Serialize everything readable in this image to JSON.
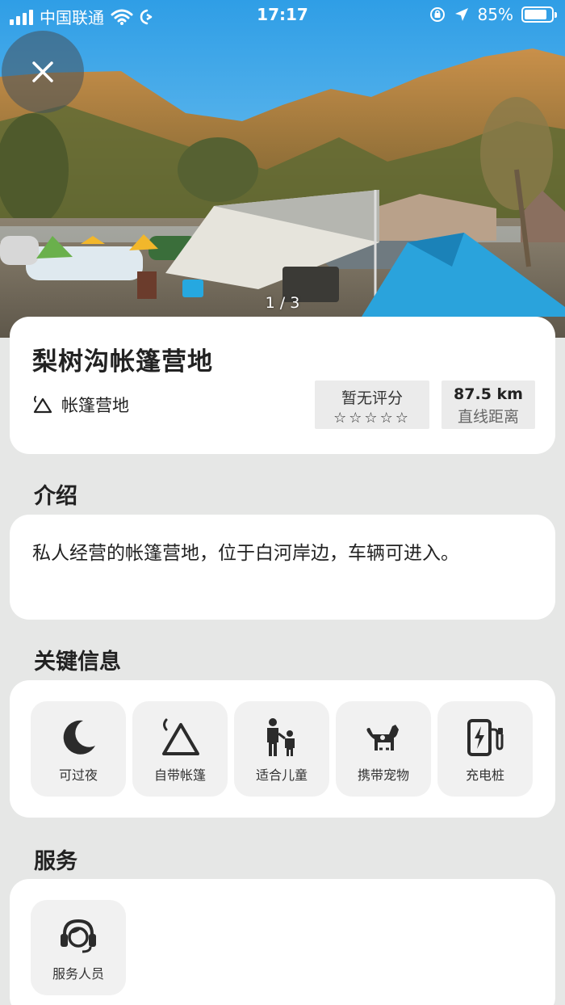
{
  "status_bar": {
    "carrier": "中国联通",
    "time": "17:17",
    "battery": "85%",
    "battery_level": 0.85
  },
  "gallery": {
    "pager": "1 / 3"
  },
  "place": {
    "name": "梨树沟帐篷营地",
    "type_label": "帐篷营地",
    "type_icon": "tent-icon",
    "rating_text": "暂无评分",
    "stars": "☆☆☆☆☆",
    "distance_value": "87.5 km",
    "distance_label": "直线距离"
  },
  "sections": {
    "intro_title": "介绍",
    "intro_text": "私人经营的帐篷营地，位于白河岸边，车辆可进入。",
    "key_info_title": "关键信息",
    "service_title": "服务"
  },
  "key_info": [
    {
      "label": "可过夜",
      "icon": "moon-icon"
    },
    {
      "label": "自带帐篷",
      "icon": "tent-icon"
    },
    {
      "label": "适合儿童",
      "icon": "family-icon"
    },
    {
      "label": "携带宠物",
      "icon": "dog-icon"
    },
    {
      "label": "充电桩",
      "icon": "ev-charger-icon"
    }
  ],
  "services": [
    {
      "label": "服务人员",
      "icon": "headset-icon"
    }
  ],
  "colors": {
    "background": "#e6e7e6",
    "card": "#ffffff",
    "tile": "#f1f1f1",
    "icon": "#2b2b2b"
  }
}
